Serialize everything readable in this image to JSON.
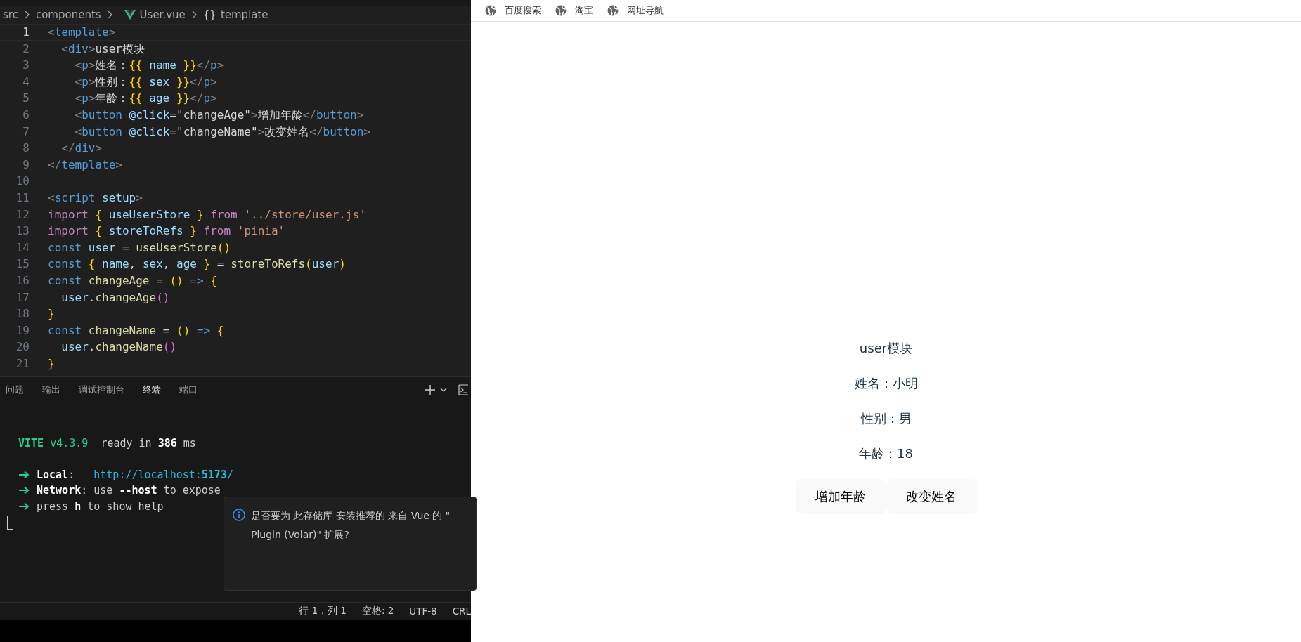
{
  "editor": {
    "breadcrumbs": [
      {
        "label": "src",
        "kind": "folder"
      },
      {
        "label": "components",
        "kind": "folder"
      },
      {
        "label": "User.vue",
        "kind": "vue"
      },
      {
        "label": "template",
        "kind": "symbol",
        "symbol": "{}"
      }
    ],
    "lines": [
      {
        "number": "1",
        "current": true,
        "tokens": [
          {
            "kind": "tb",
            "text": "<"
          },
          {
            "kind": "tn",
            "text": "template"
          },
          {
            "kind": "tb",
            "text": ">"
          }
        ]
      },
      {
        "number": "2",
        "current": false,
        "tokens": [
          {
            "kind": "tb",
            "text": "  <"
          },
          {
            "kind": "tn",
            "text": "div"
          },
          {
            "kind": "tb",
            "text": ">"
          },
          {
            "kind": "tx",
            "text": "user模块"
          }
        ]
      },
      {
        "number": "3",
        "current": false,
        "tokens": [
          {
            "kind": "tb",
            "text": "    <"
          },
          {
            "kind": "tn",
            "text": "p"
          },
          {
            "kind": "tb",
            "text": ">"
          },
          {
            "kind": "tx",
            "text": "姓名："
          },
          {
            "kind": "br",
            "text": "{{"
          },
          {
            "kind": "vr",
            "text": " name "
          },
          {
            "kind": "br",
            "text": "}}"
          },
          {
            "kind": "tb",
            "text": "</"
          },
          {
            "kind": "tn",
            "text": "p"
          },
          {
            "kind": "tb",
            "text": ">"
          }
        ]
      },
      {
        "number": "4",
        "current": false,
        "tokens": [
          {
            "kind": "tb",
            "text": "    <"
          },
          {
            "kind": "tn",
            "text": "p"
          },
          {
            "kind": "tb",
            "text": ">"
          },
          {
            "kind": "tx",
            "text": "性别："
          },
          {
            "kind": "br",
            "text": "{{"
          },
          {
            "kind": "vr",
            "text": " sex "
          },
          {
            "kind": "br",
            "text": "}}"
          },
          {
            "kind": "tb",
            "text": "</"
          },
          {
            "kind": "tn",
            "text": "p"
          },
          {
            "kind": "tb",
            "text": ">"
          }
        ]
      },
      {
        "number": "5",
        "current": false,
        "tokens": [
          {
            "kind": "tb",
            "text": "    <"
          },
          {
            "kind": "tn",
            "text": "p"
          },
          {
            "kind": "tb",
            "text": ">"
          },
          {
            "kind": "tx",
            "text": "年龄："
          },
          {
            "kind": "br",
            "text": "{{"
          },
          {
            "kind": "vr",
            "text": " age "
          },
          {
            "kind": "br",
            "text": "}}"
          },
          {
            "kind": "tb",
            "text": "</"
          },
          {
            "kind": "tn",
            "text": "p"
          },
          {
            "kind": "tb",
            "text": ">"
          }
        ]
      },
      {
        "number": "6",
        "current": false,
        "tokens": [
          {
            "kind": "tb",
            "text": "    <"
          },
          {
            "kind": "tn",
            "text": "button "
          },
          {
            "kind": "vr",
            "text": "@click"
          },
          {
            "kind": "tx",
            "text": "=\"changeAge\""
          },
          {
            "kind": "tb",
            "text": ">"
          },
          {
            "kind": "tx",
            "text": "增加年龄"
          },
          {
            "kind": "tb",
            "text": "</"
          },
          {
            "kind": "tn",
            "text": "button"
          },
          {
            "kind": "tb",
            "text": ">"
          }
        ]
      },
      {
        "number": "7",
        "current": false,
        "tokens": [
          {
            "kind": "tb",
            "text": "    <"
          },
          {
            "kind": "tn",
            "text": "button "
          },
          {
            "kind": "vr",
            "text": "@click"
          },
          {
            "kind": "tx",
            "text": "=\"changeName\""
          },
          {
            "kind": "tb",
            "text": ">"
          },
          {
            "kind": "tx",
            "text": "改变姓名"
          },
          {
            "kind": "tb",
            "text": "</"
          },
          {
            "kind": "tn",
            "text": "button"
          },
          {
            "kind": "tb",
            "text": ">"
          }
        ]
      },
      {
        "number": "8",
        "current": false,
        "tokens": [
          {
            "kind": "tb",
            "text": "  </"
          },
          {
            "kind": "tn",
            "text": "div"
          },
          {
            "kind": "tb",
            "text": ">"
          }
        ]
      },
      {
        "number": "9",
        "current": false,
        "tokens": [
          {
            "kind": "tb",
            "text": "</"
          },
          {
            "kind": "tn",
            "text": "template"
          },
          {
            "kind": "tb",
            "text": ">"
          }
        ]
      },
      {
        "number": "10",
        "current": false
      },
      {
        "number": "11",
        "current": false,
        "tokens": [
          {
            "kind": "tb",
            "text": "<"
          },
          {
            "kind": "tn",
            "text": "script "
          },
          {
            "kind": "vr",
            "text": "setup"
          },
          {
            "kind": "tb",
            "text": ">"
          }
        ]
      },
      {
        "number": "12",
        "current": false,
        "tokens": [
          {
            "kind": "kw",
            "text": "import "
          },
          {
            "kind": "br",
            "text": "{"
          },
          {
            "kind": "vr",
            "text": " useUserStore "
          },
          {
            "kind": "br",
            "text": "}"
          },
          {
            "kind": "kw",
            "text": " from "
          },
          {
            "kind": "st",
            "text": "'../store/user.js'"
          }
        ]
      },
      {
        "number": "13",
        "current": false,
        "tokens": [
          {
            "kind": "kw",
            "text": "import "
          },
          {
            "kind": "br",
            "text": "{"
          },
          {
            "kind": "vr",
            "text": " storeToRefs "
          },
          {
            "kind": "br",
            "text": "}"
          },
          {
            "kind": "kw",
            "text": " from "
          },
          {
            "kind": "st",
            "text": "'pinia'"
          }
        ]
      },
      {
        "number": "14",
        "current": false,
        "tokens": [
          {
            "kind": "cn",
            "text": "const "
          },
          {
            "kind": "vr",
            "text": "user"
          },
          {
            "kind": "tx",
            "text": " = "
          },
          {
            "kind": "fn",
            "text": "useUserStore"
          },
          {
            "kind": "br",
            "text": "()"
          }
        ]
      },
      {
        "number": "15",
        "current": false,
        "tokens": [
          {
            "kind": "cn",
            "text": "const "
          },
          {
            "kind": "br",
            "text": "{"
          },
          {
            "kind": "vr",
            "text": " name"
          },
          {
            "kind": "tx",
            "text": ", "
          },
          {
            "kind": "vr",
            "text": "sex"
          },
          {
            "kind": "tx",
            "text": ", "
          },
          {
            "kind": "vr",
            "text": "age "
          },
          {
            "kind": "br",
            "text": "}"
          },
          {
            "kind": "tx",
            "text": " = "
          },
          {
            "kind": "fn",
            "text": "storeToRefs"
          },
          {
            "kind": "br",
            "text": "("
          },
          {
            "kind": "vr",
            "text": "user"
          },
          {
            "kind": "br",
            "text": ")"
          }
        ]
      },
      {
        "number": "16",
        "current": false,
        "tokens": [
          {
            "kind": "cn",
            "text": "const "
          },
          {
            "kind": "fn",
            "text": "changeAge"
          },
          {
            "kind": "tx",
            "text": " = "
          },
          {
            "kind": "br",
            "text": "()"
          },
          {
            "kind": "cn",
            "text": " => "
          },
          {
            "kind": "br",
            "text": "{"
          }
        ]
      },
      {
        "number": "17",
        "current": false,
        "tokens": [
          {
            "kind": "vr",
            "text": "  user"
          },
          {
            "kind": "tx",
            "text": "."
          },
          {
            "kind": "fn",
            "text": "changeAge"
          },
          {
            "kind": "pp",
            "text": "()"
          }
        ]
      },
      {
        "number": "18",
        "current": false,
        "tokens": [
          {
            "kind": "br",
            "text": "}"
          }
        ]
      },
      {
        "number": "19",
        "current": false,
        "tokens": [
          {
            "kind": "cn",
            "text": "const "
          },
          {
            "kind": "fn",
            "text": "changeName"
          },
          {
            "kind": "tx",
            "text": " = "
          },
          {
            "kind": "br",
            "text": "()"
          },
          {
            "kind": "cn",
            "text": " => "
          },
          {
            "kind": "br",
            "text": "{"
          }
        ]
      },
      {
        "number": "20",
        "current": false,
        "tokens": [
          {
            "kind": "vr",
            "text": "  user"
          },
          {
            "kind": "tx",
            "text": "."
          },
          {
            "kind": "fn",
            "text": "changeName"
          },
          {
            "kind": "pp",
            "text": "()"
          }
        ]
      },
      {
        "number": "21",
        "current": false,
        "tokens": [
          {
            "kind": "br",
            "text": "}"
          }
        ]
      }
    ]
  },
  "panel": {
    "tabs": [
      {
        "label": "问题",
        "selected": false
      },
      {
        "label": "输出",
        "selected": false
      },
      {
        "label": "调试控制台",
        "selected": false
      },
      {
        "label": "终端",
        "selected": true
      },
      {
        "label": "端口",
        "selected": false
      }
    ],
    "terminal": [
      {
        "arrow": false,
        "tokens": [
          {
            "kind": "gb",
            "text": "VITE"
          },
          {
            "kind": "g",
            "text": " v4.3.9"
          },
          {
            "kind": "t",
            "text": "  ready in "
          },
          {
            "kind": "b",
            "text": "386"
          },
          {
            "kind": "t",
            "text": " ms"
          }
        ]
      },
      {
        "arrow": true,
        "tokens": [
          {
            "kind": "b",
            "text": "Local"
          },
          {
            "kind": "t",
            "text": ":   "
          },
          {
            "kind": "u",
            "text": "http://localhost:"
          },
          {
            "kind": "ub",
            "text": "5173"
          },
          {
            "kind": "u",
            "text": "/"
          }
        ]
      },
      {
        "arrow": true,
        "tokens": [
          {
            "kind": "b",
            "text": "Network"
          },
          {
            "kind": "t",
            "text": ": use "
          },
          {
            "kind": "b",
            "text": "--host"
          },
          {
            "kind": "t",
            "text": " to expose"
          }
        ]
      },
      {
        "arrow": true,
        "tokens": [
          {
            "kind": "t",
            "text": "press "
          },
          {
            "kind": "b",
            "text": "h"
          },
          {
            "kind": "t",
            "text": " to show help"
          }
        ]
      }
    ],
    "notification": {
      "lines": [
        "是否要为 此存储库 安装推荐的 来自 Vue 的 \"",
        "Plugin (Volar)\" 扩展?"
      ]
    }
  },
  "status_bar": [
    "行 1，列 1",
    "空格: 2",
    "UTF-8",
    "CRL"
  ],
  "browser": {
    "bookmarks": [
      "百度搜索",
      "淘宝",
      "网址导航"
    ],
    "page": {
      "title": "user模块",
      "fields": [
        "姓名：小明",
        "性别：男",
        "年龄：18"
      ],
      "buttons": [
        "增加年龄",
        "改变姓名"
      ]
    }
  }
}
